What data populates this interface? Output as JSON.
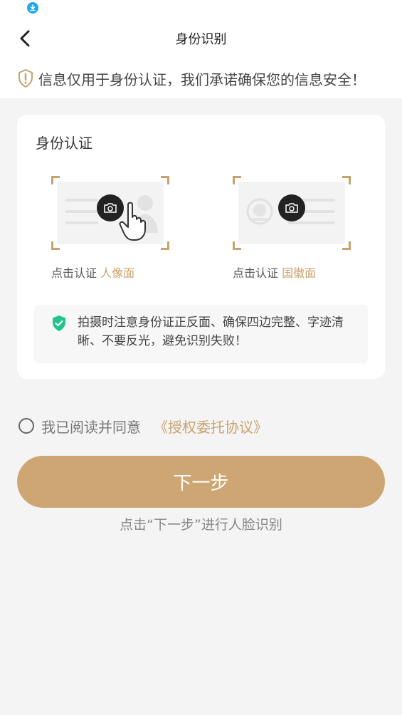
{
  "header": {
    "title": "身份识别"
  },
  "notice": {
    "text": "信息仅用于身份认证，我们承诺确保您的信息安全！"
  },
  "card": {
    "title": "身份认证",
    "front": {
      "prefix": "点击认证",
      "side": "人像面"
    },
    "back": {
      "prefix": "点击认证",
      "side": "国徽面"
    },
    "tip": "拍摄时注意身份证正反面、确保四边完整、字迹清晰、不要反光，避免识别失败！"
  },
  "agreement": {
    "text": "我已阅读并同意",
    "link": "《授权委托协议》"
  },
  "next_button": {
    "label": "下一步"
  },
  "next_hint": "点击“下一步”进行人脸识别",
  "colors": {
    "accent": "#c8a26d",
    "button": "#cea673",
    "shield": "#1fc58a",
    "background": "#f4f4f4"
  },
  "icons": [
    "download-icon",
    "back-arrow-icon",
    "warning-shield-icon",
    "camera-icon",
    "hand-pointer-icon",
    "portrait-icon",
    "emblem-icon",
    "check-shield-icon",
    "radio-icon"
  ]
}
